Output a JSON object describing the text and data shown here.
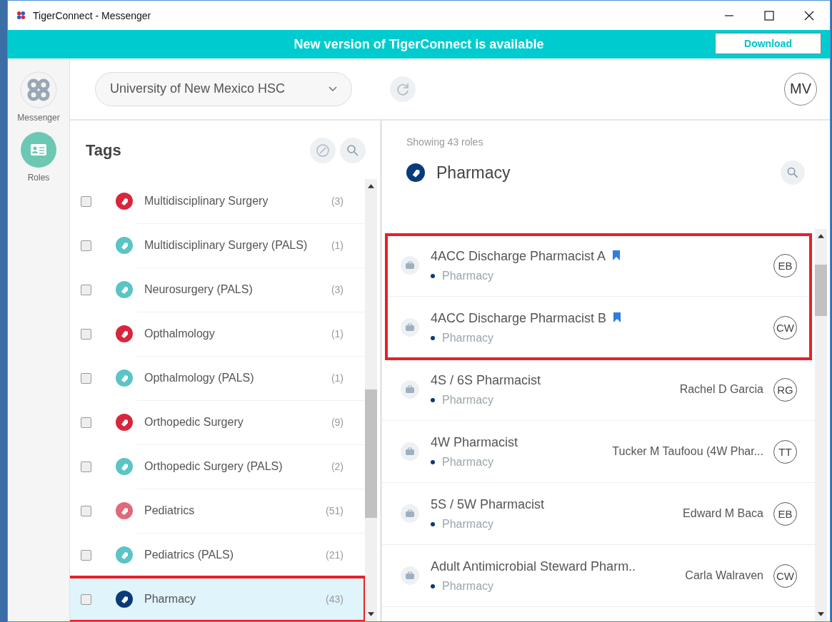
{
  "window": {
    "title": "TigerConnect - Messenger"
  },
  "banner": {
    "message": "New version of TigerConnect is available",
    "button": "Download"
  },
  "sidebar": {
    "items": [
      {
        "label": "Messenger",
        "kind": "messenger",
        "selected": false
      },
      {
        "label": "Roles",
        "kind": "roles",
        "selected": true
      }
    ]
  },
  "header": {
    "organization": "University of New Mexico HSC",
    "avatar": "MV"
  },
  "tags": {
    "title": "Tags",
    "items": [
      {
        "label": "Multidisciplinary Surgery",
        "count": "(3)",
        "color": "#d7263d",
        "checked": false,
        "selected": false,
        "highlighted": false
      },
      {
        "label": "Multidisciplinary Surgery (PALS)",
        "count": "(1)",
        "color": "#5bc4c4",
        "checked": false,
        "selected": false,
        "highlighted": false
      },
      {
        "label": "Neurosurgery (PALS)",
        "count": "(3)",
        "color": "#5bc4c4",
        "checked": false,
        "selected": false,
        "highlighted": false
      },
      {
        "label": "Opthalmology",
        "count": "(1)",
        "color": "#d7263d",
        "checked": false,
        "selected": false,
        "highlighted": false
      },
      {
        "label": "Opthalmology (PALS)",
        "count": "(1)",
        "color": "#5bc4c4",
        "checked": false,
        "selected": false,
        "highlighted": false
      },
      {
        "label": "Orthopedic Surgery",
        "count": "(9)",
        "color": "#d7263d",
        "checked": false,
        "selected": false,
        "highlighted": false
      },
      {
        "label": "Orthopedic Surgery (PALS)",
        "count": "(2)",
        "color": "#5bc4c4",
        "checked": false,
        "selected": false,
        "highlighted": false
      },
      {
        "label": "Pediatrics",
        "count": "(51)",
        "color": "#e0697a",
        "checked": false,
        "selected": false,
        "highlighted": false
      },
      {
        "label": "Pediatrics (PALS)",
        "count": "(21)",
        "color": "#5bc4c4",
        "checked": false,
        "selected": false,
        "highlighted": false
      },
      {
        "label": "Pharmacy",
        "count": "(43)",
        "color": "#0a3a7a",
        "checked": false,
        "selected": true,
        "highlighted": true
      }
    ]
  },
  "roles": {
    "summary": "Showing 43 roles",
    "tag": {
      "label": "Pharmacy",
      "color": "#0a3a7a"
    },
    "items": [
      {
        "name": "4ACC Discharge Pharmacist A",
        "tag": "Pharmacy",
        "bookmarked": true,
        "avatar": "EB",
        "highlighted": true
      },
      {
        "name": "4ACC Discharge Pharmacist B",
        "tag": "Pharmacy",
        "bookmarked": true,
        "avatar": "CW",
        "highlighted": true
      },
      {
        "name": "4S / 6S Pharmacist",
        "tag": "Pharmacy",
        "bookmarked": false,
        "person": "Rachel D Garcia",
        "avatar": "RG",
        "highlighted": false
      },
      {
        "name": "4W Pharmacist",
        "tag": "Pharmacy",
        "bookmarked": false,
        "person": "Tucker M Taufoou (4W Phar...",
        "avatar": "TT",
        "highlighted": false
      },
      {
        "name": "5S / 5W Pharmacist",
        "tag": "Pharmacy",
        "bookmarked": false,
        "person": "Edward M Baca",
        "avatar": "EB",
        "highlighted": false
      },
      {
        "name": "Adult Antimicrobial Steward Pharm..",
        "tag": "Pharmacy",
        "bookmarked": false,
        "person": "Carla Walraven",
        "avatar": "CW",
        "highlighted": false
      }
    ]
  }
}
